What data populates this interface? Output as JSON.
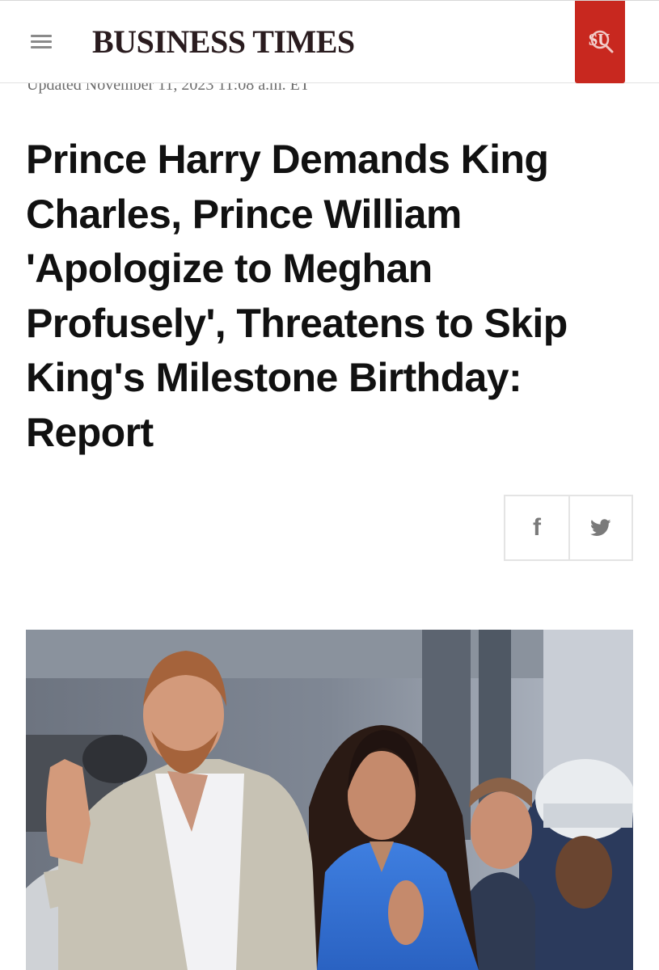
{
  "header": {
    "brand": "BUSINESS TIMES",
    "search_label": "SU",
    "accent_color": "#c8281f",
    "menu_icon": "hamburger-menu-icon",
    "search_icon": "search-icon"
  },
  "article": {
    "updated": "Updated November 11, 2023 11:08 a.m. ET",
    "headline": "Prince Harry Demands King Charles, Prince William 'Apologize to Meghan Profusely', Threatens to Skip King's Milestone Birthday: Report"
  },
  "share": {
    "facebook_icon": "facebook-icon",
    "facebook_label": "f",
    "twitter_icon": "twitter-icon"
  },
  "hero_image": {
    "kind": "photo"
  }
}
